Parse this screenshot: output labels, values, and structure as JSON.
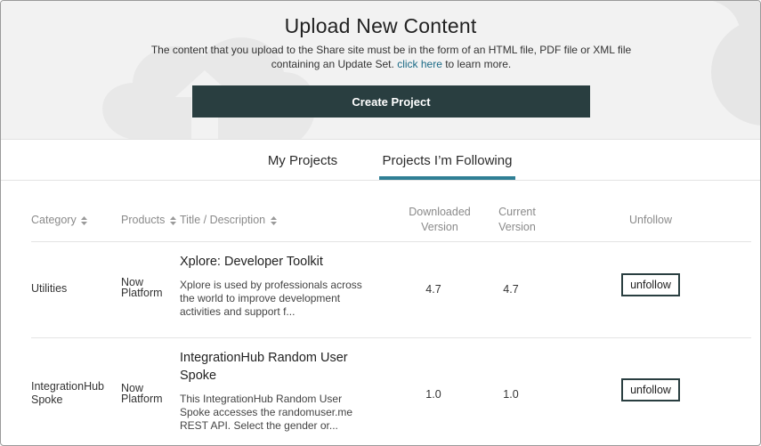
{
  "header": {
    "title": "Upload New Content",
    "description": "The content that you upload to the Share site must be in the form of an HTML file, PDF file or XML file containing an Update Set.",
    "link_text": "click here",
    "link_suffix": " to learn more.",
    "create_button": "Create Project"
  },
  "tabs": [
    {
      "label": "My Projects",
      "active": false
    },
    {
      "label": "Projects I’m Following",
      "active": true
    }
  ],
  "table": {
    "columns": {
      "category": "Category",
      "products": "Products",
      "title": "Title / Description",
      "downloaded_1": "Downloaded",
      "downloaded_2": "Version",
      "current_1": "Current",
      "current_2": "Version",
      "unfollow": "Unfollow"
    },
    "rows": [
      {
        "category": "Utilities",
        "category_2": "",
        "product_1": "Now",
        "product_2": "Platform",
        "title_1": "Xplore: Developer Toolkit",
        "title_2": "",
        "desc_1": "Xplore is used by professionals across",
        "desc_2": "the world to improve development",
        "desc_3": "activities and support f...",
        "downloaded": "4.7",
        "current": "4.7",
        "action": "unfollow"
      },
      {
        "category": "IntegrationHub",
        "category_2": "Spoke",
        "product_1": "Now",
        "product_2": "Platform",
        "title_1": "IntegrationHub Random User",
        "title_2": "Spoke",
        "desc_1": "This IntegrationHub Random User",
        "desc_2": "Spoke accesses the randomuser.me",
        "desc_3": "REST API. Select the gender or...",
        "downloaded": "1.0",
        "current": "1.0",
        "action": "unfollow"
      }
    ]
  },
  "colors": {
    "accent": "#2f7f95",
    "button_dark": "#293e40",
    "link": "#1b6a86"
  }
}
